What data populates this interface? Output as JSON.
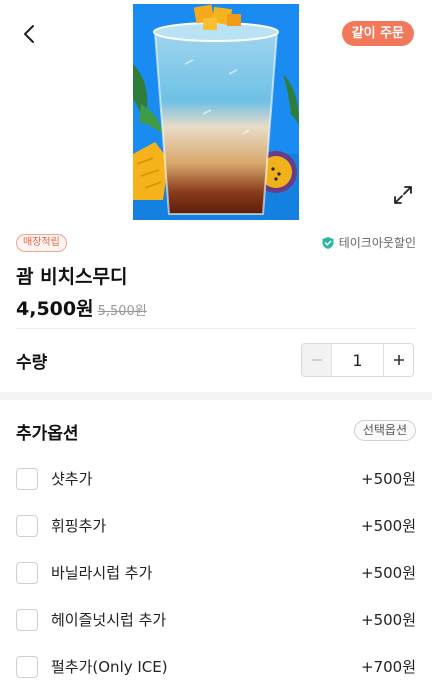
{
  "header": {
    "group_order_label": "같이 주문"
  },
  "product": {
    "store_badge": "매장적립",
    "takeout_label": "테이크아웃할인",
    "name": "괌 비치스무디",
    "price": "4,500원",
    "original_price": "5,500원"
  },
  "quantity": {
    "label": "수량",
    "value": "1"
  },
  "options": {
    "title": "추가옵션",
    "badge": "선택옵션",
    "items": [
      {
        "name": "샷추가",
        "price": "+500원"
      },
      {
        "name": "휘핑추가",
        "price": "+500원"
      },
      {
        "name": "바닐라시럽 추가",
        "price": "+500원"
      },
      {
        "name": "헤이즐넛시럽 추가",
        "price": "+500원"
      },
      {
        "name": "펄추가(Only ICE)",
        "price": "+700원"
      }
    ]
  },
  "colors": {
    "accent": "#f1785a",
    "photo_background": "#1a8bf0"
  },
  "icons": [
    "chevron-left-icon",
    "expand-icon",
    "shield-check-icon",
    "minus-icon",
    "plus-icon"
  ]
}
